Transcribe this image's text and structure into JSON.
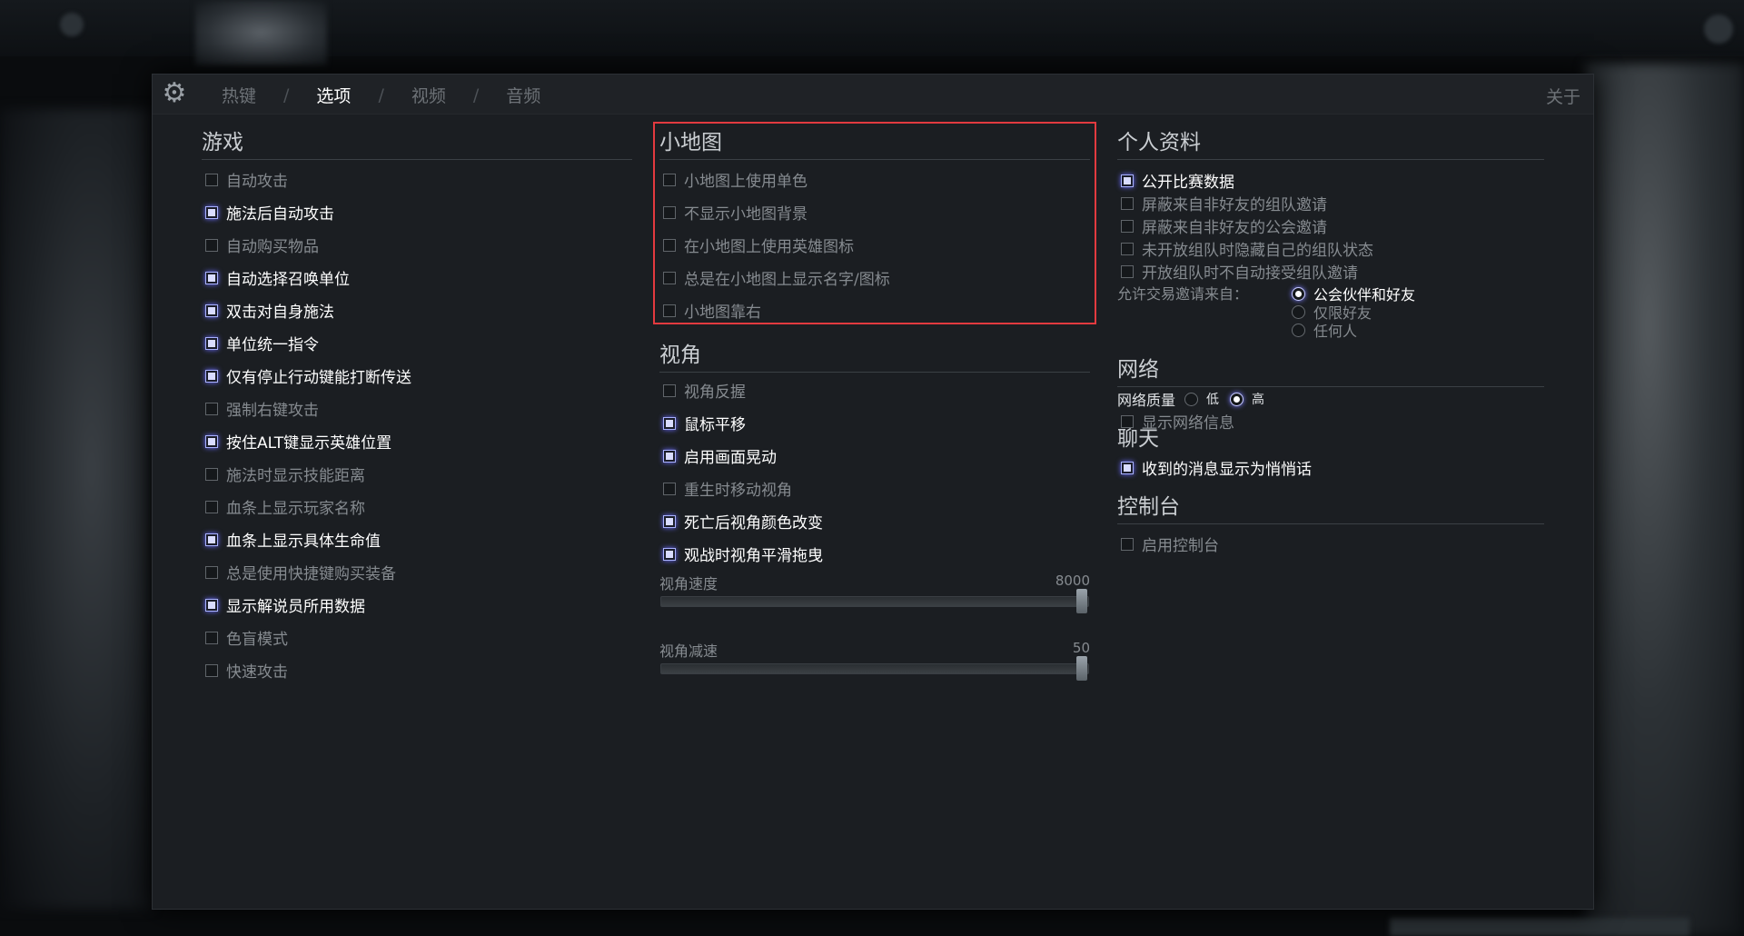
{
  "tabs": {
    "items": [
      "热键",
      "选项",
      "视频",
      "音频"
    ],
    "active_index": 1,
    "separator": "/",
    "about": "关于"
  },
  "game": {
    "title": "游戏",
    "options": [
      {
        "label": "自动攻击",
        "checked": false
      },
      {
        "label": "施法后自动攻击",
        "checked": true
      },
      {
        "label": "自动购买物品",
        "checked": false
      },
      {
        "label": "自动选择召唤单位",
        "checked": true
      },
      {
        "label": "双击对自身施法",
        "checked": true
      },
      {
        "label": "单位统一指令",
        "checked": true
      },
      {
        "label": "仅有停止行动键能打断传送",
        "checked": true
      },
      {
        "label": "强制右键攻击",
        "checked": false
      },
      {
        "label": "按住ALT键显示英雄位置",
        "checked": true
      },
      {
        "label": "施法时显示技能距离",
        "checked": false
      },
      {
        "label": "血条上显示玩家名称",
        "checked": false
      },
      {
        "label": "血条上显示具体生命值",
        "checked": true
      },
      {
        "label": "总是使用快捷键购买装备",
        "checked": false
      },
      {
        "label": "显示解说员所用数据",
        "checked": true
      },
      {
        "label": "色盲模式",
        "checked": false
      },
      {
        "label": "快速攻击",
        "checked": false
      }
    ]
  },
  "minimap": {
    "title": "小地图",
    "options": [
      {
        "label": "小地图上使用单色",
        "checked": false
      },
      {
        "label": "不显示小地图背景",
        "checked": false
      },
      {
        "label": "在小地图上使用英雄图标",
        "checked": false
      },
      {
        "label": "总是在小地图上显示名字/图标",
        "checked": false
      },
      {
        "label": "小地图靠右",
        "checked": false
      }
    ]
  },
  "camera": {
    "title": "视角",
    "options": [
      {
        "label": "视角反握",
        "checked": false
      },
      {
        "label": "鼠标平移",
        "checked": true
      },
      {
        "label": "启用画面晃动",
        "checked": true
      },
      {
        "label": "重生时移动视角",
        "checked": false
      },
      {
        "label": "死亡后视角颜色改变",
        "checked": true
      },
      {
        "label": "观战时视角平滑拖曳",
        "checked": true
      }
    ],
    "speed": {
      "label": "视角速度",
      "value": "8000",
      "fraction": 1.0
    },
    "decel": {
      "label": "视角减速",
      "value": "50",
      "fraction": 1.0
    }
  },
  "profile": {
    "title": "个人资料",
    "options": [
      {
        "label": "公开比赛数据",
        "checked": true
      },
      {
        "label": "屏蔽来自非好友的组队邀请",
        "checked": false
      },
      {
        "label": "屏蔽来自非好友的公会邀请",
        "checked": false
      },
      {
        "label": "未开放组队时隐藏自己的组队状态",
        "checked": false
      },
      {
        "label": "开放组队时不自动接受组队邀请",
        "checked": false
      }
    ],
    "trade_label": "允许交易邀请来自：",
    "trade_options": [
      {
        "label": "公会伙伴和好友",
        "selected": true
      },
      {
        "label": "仅限好友",
        "selected": false
      },
      {
        "label": "任何人",
        "selected": false
      }
    ]
  },
  "network": {
    "title": "网络",
    "quality_label": "网络质量",
    "quality_options": [
      {
        "label": "低",
        "selected": false
      },
      {
        "label": "高",
        "selected": true
      }
    ],
    "options": [
      {
        "label": "显示网络信息",
        "checked": false
      }
    ]
  },
  "chat": {
    "title": "聊天",
    "options": [
      {
        "label": "收到的消息显示为悄悄话",
        "checked": true
      }
    ]
  },
  "console": {
    "title": "控制台",
    "options": [
      {
        "label": "启用控制台",
        "checked": false
      }
    ]
  }
}
